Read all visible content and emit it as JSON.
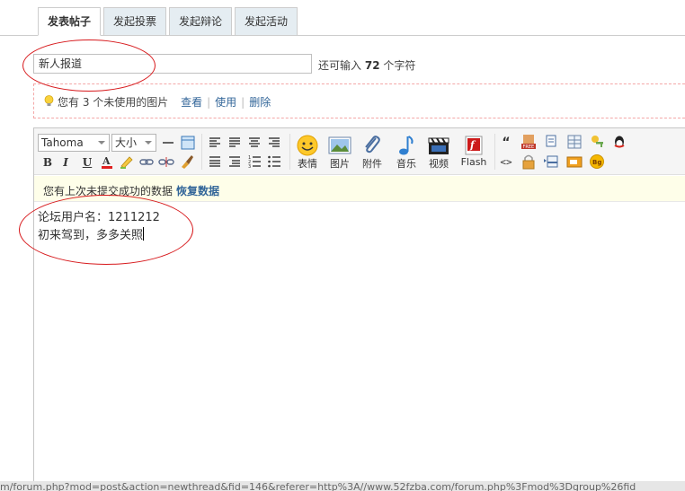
{
  "tabs": [
    "发表帖子",
    "发起投票",
    "发起辩论",
    "发起活动"
  ],
  "subject": {
    "value": "新人报道"
  },
  "char_hint": {
    "prefix": "还可输入",
    "count": "72",
    "suffix": "个字符"
  },
  "attach_notice": {
    "text": "您有 3 个未使用的图片",
    "view": "查看",
    "use": "使用",
    "delete": "删除"
  },
  "toolbar": {
    "font": "Tahoma",
    "size": "大小",
    "bold": "B",
    "italic": "I",
    "underline": "U",
    "emotion": "表情",
    "image": "图片",
    "attachment": "附件",
    "music": "音乐",
    "video": "视频",
    "flash": "Flash",
    "quote": "“",
    "code": "<>",
    "free_icon_text": "FREE",
    "bg_icon_text": "Bg"
  },
  "restore": {
    "text": "您有上次未提交成功的数据",
    "link": "恢复数据"
  },
  "content": {
    "line1": "论坛用户名：1211212",
    "line2": "初来驾到，多多关照"
  },
  "status_bar": "m/forum.php?mod=post&action=newthread&fid=146&referer=http%3A//www.52fzba.com/forum.php%3Fmod%3Dgroup%26fid",
  "colors": {
    "tab_bg": "#e5edf2",
    "link": "#336699",
    "annotation": "#d7191c",
    "restore_bg": "#fefee9"
  }
}
